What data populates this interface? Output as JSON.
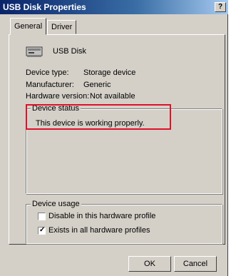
{
  "window": {
    "title": "USB Disk Properties",
    "help_label": "?"
  },
  "tabs": [
    {
      "label": "General",
      "active": true
    },
    {
      "label": "Driver",
      "active": false
    }
  ],
  "device": {
    "icon": "usb-drive-icon",
    "name": "USB Disk"
  },
  "properties": [
    {
      "label": "Device type:",
      "value": "Storage device"
    },
    {
      "label": "Manufacturer:",
      "value": "Generic"
    },
    {
      "label": "Hardware version:",
      "value": "Not available"
    }
  ],
  "status": {
    "title": "Device status",
    "text": "This device is working properly."
  },
  "usage": {
    "title": "Device usage",
    "options": [
      {
        "label": "Disable in this hardware profile",
        "checked": false
      },
      {
        "label": "Exists in all hardware profiles",
        "checked": true
      }
    ]
  },
  "buttons": {
    "ok": "OK",
    "cancel": "Cancel"
  },
  "colors": {
    "title_bar": "#0a246a",
    "highlight": "#e0102a",
    "face": "#d4d0c8"
  }
}
